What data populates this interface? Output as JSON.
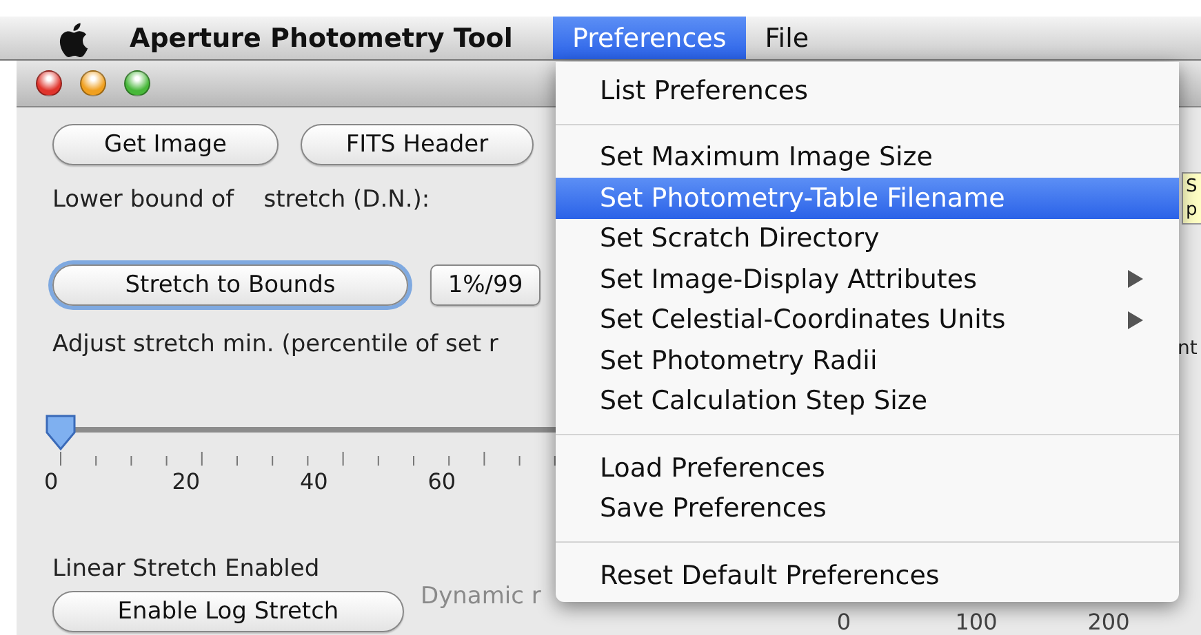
{
  "menubar": {
    "app_title": "Aperture Photometry Tool",
    "menus": [
      {
        "label": "Preferences",
        "selected": true
      },
      {
        "label": "File",
        "selected": false
      }
    ]
  },
  "left_panel": {
    "top_buttons": [
      {
        "label": "Get Image",
        "focused": false
      },
      {
        "label": "FITS Header",
        "focused": false
      }
    ],
    "lower_bound_label": "Lower bound of    stretch (D.N.):",
    "stretch_buttons": [
      {
        "label": "Stretch to Bounds",
        "focused": true
      },
      {
        "label": "1%/99",
        "focused": false
      }
    ],
    "adjust_label": "Adjust stretch min. (percentile of set r",
    "slider": {
      "level": 0,
      "tick_labels": [
        "0",
        "20",
        "40",
        "60"
      ]
    },
    "status_label": "Linear Stretch Enabled",
    "log_button": {
      "label": "Enable Log Stretch",
      "focused": false
    },
    "dynamic_label": "Dynamic r"
  },
  "right_edge": {
    "label_fragment": "nt",
    "tooltip_lines": [
      "S",
      "p"
    ]
  },
  "bottom_scale": {
    "tick_labels": [
      "0",
      "100",
      "200"
    ]
  },
  "menu": {
    "items": [
      {
        "kind": "item",
        "label": "List Preferences",
        "selected": false,
        "submenu": false
      },
      {
        "kind": "separator"
      },
      {
        "kind": "item",
        "label": "Set Maximum Image Size",
        "selected": false,
        "submenu": false
      },
      {
        "kind": "item",
        "label": "Set Photometry-Table Filename",
        "selected": true,
        "submenu": false
      },
      {
        "kind": "item",
        "label": "Set Scratch Directory",
        "selected": false,
        "submenu": false
      },
      {
        "kind": "item",
        "label": "Set Image-Display Attributes",
        "selected": false,
        "submenu": true
      },
      {
        "kind": "item",
        "label": "Set Celestial-Coordinates Units",
        "selected": false,
        "submenu": true
      },
      {
        "kind": "item",
        "label": "Set Photometry Radii",
        "selected": false,
        "submenu": false
      },
      {
        "kind": "item",
        "label": "Set Calculation Step Size",
        "selected": false,
        "submenu": false
      },
      {
        "kind": "separator"
      },
      {
        "kind": "item",
        "label": "Load Preferences",
        "selected": false,
        "submenu": false
      },
      {
        "kind": "item",
        "label": "Save Preferences",
        "selected": false,
        "submenu": false
      },
      {
        "kind": "separator"
      },
      {
        "kind": "item",
        "label": "Reset Default Preferences",
        "selected": false,
        "submenu": false
      }
    ]
  }
}
